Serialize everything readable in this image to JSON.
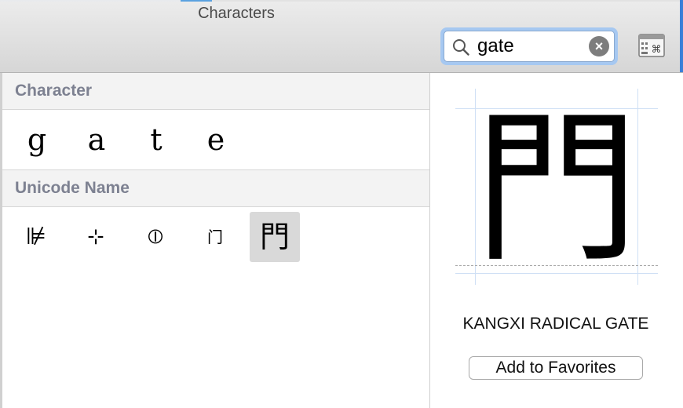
{
  "window": {
    "title": "Characters"
  },
  "search": {
    "value": "gate",
    "clear_label": "×"
  },
  "sections": {
    "character_header": "Character",
    "unicode_header": "Unicode Name"
  },
  "character_results": [
    "g",
    "a",
    "t",
    "e"
  ],
  "unicode_results": [
    {
      "glyph": "⊯",
      "selected": false
    },
    {
      "glyph": "⊹",
      "selected": false
    },
    {
      "glyph": "⦶",
      "selected": false
    },
    {
      "glyph": "门",
      "selected": false
    },
    {
      "glyph": "門",
      "selected": true
    }
  ],
  "detail": {
    "glyph": "門",
    "name": "KANGXI RADICAL GATE",
    "add_favorites_label": "Add to Favorites"
  },
  "colors": {
    "accent": "#3b7fd8",
    "search_focus": "#a6c8f1",
    "section_header_text": "#7d8191",
    "selected_cell": "#d9d9d9"
  },
  "icons": {
    "search": "magnifier-icon",
    "clear": "clear-search-icon",
    "keyboard": "keyboard-viewer-icon"
  }
}
